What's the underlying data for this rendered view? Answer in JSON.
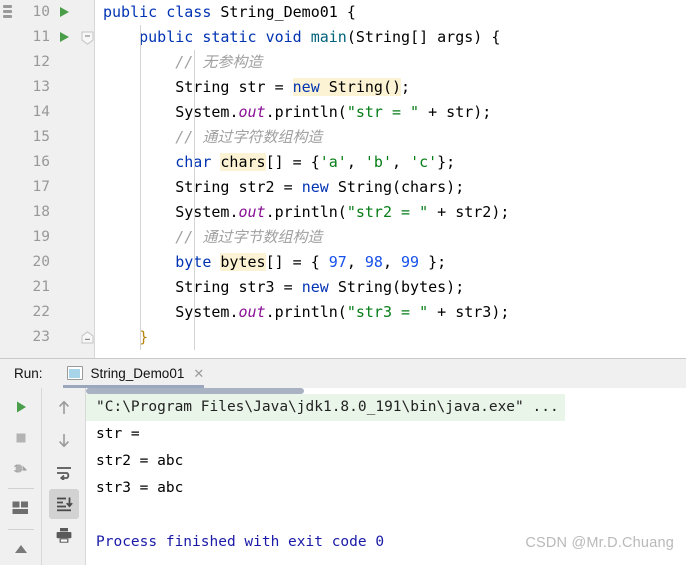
{
  "editor": {
    "first_line_number": 10,
    "lines": [
      {
        "number": 10,
        "run_marker": true,
        "fold": "open",
        "indent": 0,
        "tokens": [
          {
            "t": "public",
            "c": "kw"
          },
          {
            "t": " ",
            "c": "pln"
          },
          {
            "t": "class",
            "c": "kw"
          },
          {
            "t": " ",
            "c": "pln"
          },
          {
            "t": "String_Demo01",
            "c": "cls"
          },
          {
            "t": " {",
            "c": "pln"
          }
        ]
      },
      {
        "number": 11,
        "run_marker": true,
        "fold": "openbox",
        "indent": 1,
        "tokens": [
          {
            "t": "public",
            "c": "kw"
          },
          {
            "t": " ",
            "c": "pln"
          },
          {
            "t": "static",
            "c": "kw"
          },
          {
            "t": " ",
            "c": "pln"
          },
          {
            "t": "void",
            "c": "kw"
          },
          {
            "t": " ",
            "c": "pln"
          },
          {
            "t": "main",
            "c": "meth"
          },
          {
            "t": "(",
            "c": "pln"
          },
          {
            "t": "String",
            "c": "cls"
          },
          {
            "t": "[] args) {",
            "c": "pln"
          }
        ]
      },
      {
        "number": 12,
        "run_marker": false,
        "fold": "",
        "indent": 2,
        "tokens": [
          {
            "t": "// 无参构造",
            "c": "cmt"
          }
        ]
      },
      {
        "number": 13,
        "run_marker": false,
        "fold": "",
        "indent": 2,
        "tokens": [
          {
            "t": "String",
            "c": "cls"
          },
          {
            "t": " str = ",
            "c": "pln"
          },
          {
            "t": "new",
            "c": "kw hl"
          },
          {
            "t": " ",
            "c": "pln hl"
          },
          {
            "t": "String",
            "c": "cls hl"
          },
          {
            "t": "()",
            "c": "pln hl"
          },
          {
            "t": ";",
            "c": "pln"
          }
        ]
      },
      {
        "number": 14,
        "run_marker": false,
        "fold": "",
        "indent": 2,
        "tokens": [
          {
            "t": "System",
            "c": "cls"
          },
          {
            "t": ".",
            "c": "pln"
          },
          {
            "t": "out",
            "c": "fld"
          },
          {
            "t": ".println(",
            "c": "pln"
          },
          {
            "t": "\"str = \"",
            "c": "str"
          },
          {
            "t": " + str);",
            "c": "pln"
          }
        ]
      },
      {
        "number": 15,
        "run_marker": false,
        "fold": "",
        "indent": 2,
        "tokens": [
          {
            "t": "// 通过字符数组构造",
            "c": "cmt"
          }
        ]
      },
      {
        "number": 16,
        "run_marker": false,
        "fold": "",
        "indent": 2,
        "tokens": [
          {
            "t": "char",
            "c": "kw"
          },
          {
            "t": " ",
            "c": "pln"
          },
          {
            "t": "chars",
            "c": "pln hl"
          },
          {
            "t": "[] = {",
            "c": "pln"
          },
          {
            "t": "'a'",
            "c": "str"
          },
          {
            "t": ", ",
            "c": "pln"
          },
          {
            "t": "'b'",
            "c": "str"
          },
          {
            "t": ", ",
            "c": "pln"
          },
          {
            "t": "'c'",
            "c": "str"
          },
          {
            "t": "};",
            "c": "pln"
          }
        ]
      },
      {
        "number": 17,
        "run_marker": false,
        "fold": "",
        "indent": 2,
        "tokens": [
          {
            "t": "String",
            "c": "cls"
          },
          {
            "t": " str2 = ",
            "c": "pln"
          },
          {
            "t": "new",
            "c": "kw"
          },
          {
            "t": " ",
            "c": "pln"
          },
          {
            "t": "String",
            "c": "cls"
          },
          {
            "t": "(chars);",
            "c": "pln"
          }
        ]
      },
      {
        "number": 18,
        "run_marker": false,
        "fold": "",
        "indent": 2,
        "tokens": [
          {
            "t": "System",
            "c": "cls"
          },
          {
            "t": ".",
            "c": "pln"
          },
          {
            "t": "out",
            "c": "fld"
          },
          {
            "t": ".println(",
            "c": "pln"
          },
          {
            "t": "\"str2 = \"",
            "c": "str"
          },
          {
            "t": " + str2);",
            "c": "pln"
          }
        ]
      },
      {
        "number": 19,
        "run_marker": false,
        "fold": "",
        "indent": 2,
        "tokens": [
          {
            "t": "// 通过字节数组构造",
            "c": "cmt"
          }
        ]
      },
      {
        "number": 20,
        "run_marker": false,
        "fold": "",
        "indent": 2,
        "tokens": [
          {
            "t": "byte",
            "c": "kw"
          },
          {
            "t": " ",
            "c": "pln"
          },
          {
            "t": "bytes",
            "c": "pln hl"
          },
          {
            "t": "[] = { ",
            "c": "pln"
          },
          {
            "t": "97",
            "c": "num"
          },
          {
            "t": ", ",
            "c": "pln"
          },
          {
            "t": "98",
            "c": "num"
          },
          {
            "t": ", ",
            "c": "pln"
          },
          {
            "t": "99",
            "c": "num"
          },
          {
            "t": " };",
            "c": "pln"
          }
        ]
      },
      {
        "number": 21,
        "run_marker": false,
        "fold": "",
        "indent": 2,
        "tokens": [
          {
            "t": "String",
            "c": "cls"
          },
          {
            "t": " str3 = ",
            "c": "pln"
          },
          {
            "t": "new",
            "c": "kw"
          },
          {
            "t": " ",
            "c": "pln"
          },
          {
            "t": "String",
            "c": "cls"
          },
          {
            "t": "(bytes);",
            "c": "pln"
          }
        ]
      },
      {
        "number": 22,
        "run_marker": false,
        "fold": "",
        "indent": 2,
        "tokens": [
          {
            "t": "System",
            "c": "cls"
          },
          {
            "t": ".",
            "c": "pln"
          },
          {
            "t": "out",
            "c": "fld"
          },
          {
            "t": ".println(",
            "c": "pln"
          },
          {
            "t": "\"str3 = \"",
            "c": "str"
          },
          {
            "t": " + str3);",
            "c": "pln"
          }
        ]
      },
      {
        "number": 23,
        "run_marker": false,
        "fold": "close",
        "indent": 1,
        "tokens": [
          {
            "t": "}",
            "c": "brace-r"
          }
        ]
      }
    ]
  },
  "run_panel": {
    "label": "Run:",
    "tab_title": "String_Demo01",
    "tab_close": "✕",
    "toolbar_left": [
      {
        "name": "rerun-button",
        "icon": "play-icon",
        "active": false
      },
      {
        "name": "stop-button",
        "icon": "stop-icon",
        "active": false
      },
      {
        "name": "dump-threads-button",
        "icon": "bug-icon",
        "active": false
      },
      {
        "name": "layout-button",
        "icon": "layout-icon",
        "active": false
      },
      {
        "name": "expand-button",
        "icon": "up-caret-icon",
        "active": false
      }
    ],
    "toolbar_right": [
      {
        "name": "up-button",
        "icon": "arrow-up-icon",
        "active": false
      },
      {
        "name": "down-button",
        "icon": "arrow-down-icon",
        "active": false
      },
      {
        "name": "soft-wrap-button",
        "icon": "soft-wrap-icon",
        "active": false
      },
      {
        "name": "scroll-to-end-button",
        "icon": "scroll-to-end-icon",
        "active": true
      },
      {
        "name": "print-button",
        "icon": "printer-icon",
        "active": false
      }
    ],
    "console": [
      {
        "text": "\"C:\\Program Files\\Java\\jdk1.8.0_191\\bin\\java.exe\" ...",
        "style": "command"
      },
      {
        "text": "str = ",
        "style": "normal"
      },
      {
        "text": "str2 = abc",
        "style": "normal"
      },
      {
        "text": "str3 = abc",
        "style": "normal"
      },
      {
        "text": "",
        "style": "normal"
      },
      {
        "text": "Process finished with exit code 0",
        "style": "done"
      }
    ]
  },
  "watermark": "CSDN @Mr.D.Chuang",
  "colors": {
    "keyword": "#0033b3",
    "string": "#067d17",
    "number": "#1750eb",
    "comment": "#a0a0a0",
    "field": "#871094",
    "method": "#00627a",
    "highlight_bg": "#fbf3d3",
    "console_cmd_bg": "#e9f5e9",
    "console_done": "#1a1aa8",
    "run_arrow": "#4a9e4a",
    "gutter_bg": "#f0f0f0"
  }
}
